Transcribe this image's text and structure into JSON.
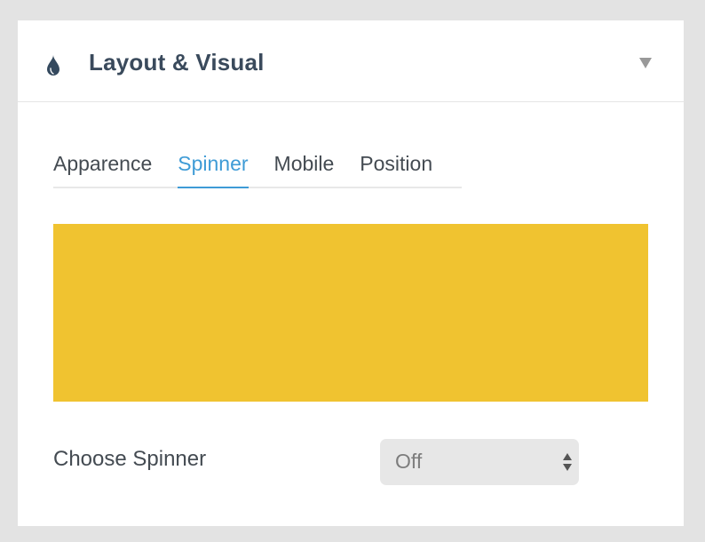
{
  "panel": {
    "title": "Layout & Visual",
    "icon": "drop-icon",
    "collapse_icon": "triangle-down-icon"
  },
  "tabs": [
    {
      "label": "Apparence",
      "active": false
    },
    {
      "label": "Spinner",
      "active": true
    },
    {
      "label": "Mobile",
      "active": false
    },
    {
      "label": "Position",
      "active": false
    }
  ],
  "preview": {
    "color": "#f0c330"
  },
  "spinner_field": {
    "label": "Choose Spinner",
    "value": "Off",
    "icon": "select-arrows-icon"
  },
  "colors": {
    "accent": "#3e9bd6",
    "heading": "#3a4a5c",
    "preview": "#f0c330"
  }
}
